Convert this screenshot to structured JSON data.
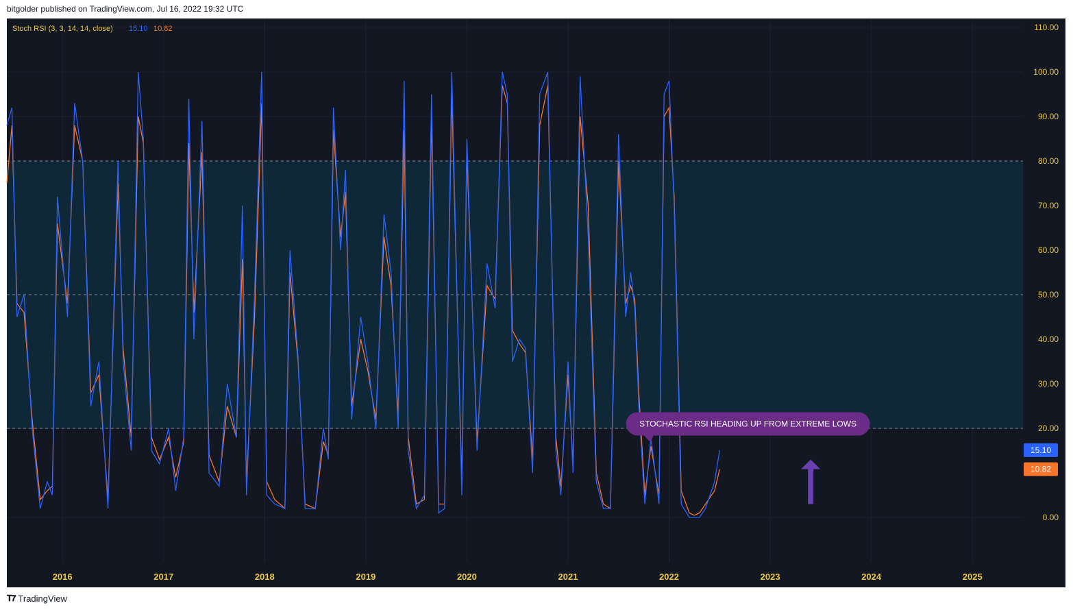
{
  "header": {
    "published_line": "bitgolder published on TradingView.com, Jul 16, 2022 19:32 UTC"
  },
  "footer": {
    "brand": "TradingView",
    "logo_icon": "tradingview-logo-icon"
  },
  "colors": {
    "background": "#131722",
    "band_fill": "#0f2a3a",
    "k_line": "#2962ff",
    "d_line": "#f7762c",
    "axis_text": "#e9c84a",
    "annotation_bg": "#6a2c86",
    "arrow": "#6a3fb0"
  },
  "chart_data": {
    "type": "line",
    "title": "",
    "indicator": {
      "name": "Stoch RSI (3, 3, 14, 14, close)",
      "k_value": "15.10",
      "d_value": "10.82"
    },
    "x_axis": {
      "labels": [
        "2016",
        "2017",
        "2018",
        "2019",
        "2020",
        "2021",
        "2022",
        "2023",
        "2024",
        "2025"
      ],
      "range": [
        2015.45,
        2025.5
      ]
    },
    "y_axis": {
      "labels": [
        "110.00",
        "100.00",
        "90.00",
        "80.00",
        "70.00",
        "60.00",
        "50.00",
        "40.00",
        "30.00",
        "20.00",
        "0.00"
      ],
      "range": [
        -10,
        112
      ]
    },
    "bands": {
      "upper": 80,
      "middle": 50,
      "lower": 20
    },
    "price_tags": [
      {
        "label": "15.10",
        "value": 15.1,
        "series": "k"
      },
      {
        "label": "10.82",
        "value": 10.82,
        "series": "d"
      }
    ],
    "annotation": {
      "text": "STOCHASTIC RSI HEADING UP FROM EXTREME LOWS",
      "x": 2022.78,
      "y": 21
    },
    "arrow": {
      "x": 2023.4,
      "y_from": 3,
      "y_to": 13
    },
    "series": [
      {
        "name": "k",
        "x": [
          2015.45,
          2015.5,
          2015.55,
          2015.62,
          2015.7,
          2015.78,
          2015.85,
          2015.9,
          2015.95,
          2016.05,
          2016.12,
          2016.2,
          2016.28,
          2016.36,
          2016.45,
          2016.55,
          2016.6,
          2016.68,
          2016.75,
          2016.8,
          2016.88,
          2016.96,
          2017.05,
          2017.12,
          2017.2,
          2017.25,
          2017.3,
          2017.38,
          2017.45,
          2017.55,
          2017.63,
          2017.72,
          2017.78,
          2017.82,
          2017.9,
          2017.97,
          2018.02,
          2018.1,
          2018.2,
          2018.25,
          2018.33,
          2018.4,
          2018.5,
          2018.58,
          2018.63,
          2018.68,
          2018.75,
          2018.8,
          2018.86,
          2018.95,
          2019.02,
          2019.1,
          2019.18,
          2019.25,
          2019.32,
          2019.38,
          2019.42,
          2019.5,
          2019.58,
          2019.65,
          2019.72,
          2019.78,
          2019.85,
          2019.95,
          2020.0,
          2020.1,
          2020.2,
          2020.28,
          2020.35,
          2020.4,
          2020.45,
          2020.52,
          2020.58,
          2020.65,
          2020.72,
          2020.8,
          2020.88,
          2020.93,
          2021.0,
          2021.05,
          2021.12,
          2021.2,
          2021.28,
          2021.35,
          2021.42,
          2021.5,
          2021.57,
          2021.62,
          2021.66,
          2021.7,
          2021.76,
          2021.82,
          2021.9,
          2021.95,
          2022.0,
          2022.05,
          2022.12,
          2022.2,
          2022.25,
          2022.3,
          2022.36,
          2022.45,
          2022.5
        ],
        "y": [
          88,
          92,
          45,
          50,
          20,
          2,
          8,
          5,
          72,
          45,
          93,
          80,
          25,
          35,
          2,
          80,
          35,
          15,
          100,
          85,
          15,
          12,
          20,
          6,
          18,
          94,
          40,
          89,
          10,
          7,
          30,
          18,
          70,
          5,
          50,
          100,
          5,
          3,
          2,
          60,
          36,
          2,
          2,
          20,
          13,
          92,
          60,
          78,
          22,
          45,
          35,
          20,
          68,
          55,
          20,
          98,
          15,
          2,
          5,
          95,
          1,
          2,
          100,
          5,
          85,
          15,
          57,
          47,
          100,
          95,
          35,
          40,
          38,
          10,
          95,
          100,
          15,
          5,
          35,
          10,
          99,
          63,
          8,
          2,
          2,
          86,
          45,
          55,
          47,
          25,
          3,
          18,
          3,
          95,
          98,
          70,
          3,
          0,
          0,
          0,
          2,
          8,
          15.1
        ]
      },
      {
        "name": "d",
        "x": [
          2015.45,
          2015.5,
          2015.55,
          2015.62,
          2015.7,
          2015.78,
          2015.85,
          2015.9,
          2015.95,
          2016.05,
          2016.12,
          2016.2,
          2016.28,
          2016.36,
          2016.45,
          2016.55,
          2016.6,
          2016.68,
          2016.75,
          2016.8,
          2016.88,
          2016.96,
          2017.05,
          2017.12,
          2017.2,
          2017.25,
          2017.3,
          2017.38,
          2017.45,
          2017.55,
          2017.63,
          2017.72,
          2017.78,
          2017.82,
          2017.9,
          2017.97,
          2018.02,
          2018.1,
          2018.2,
          2018.25,
          2018.33,
          2018.4,
          2018.5,
          2018.58,
          2018.63,
          2018.68,
          2018.75,
          2018.8,
          2018.86,
          2018.95,
          2019.02,
          2019.1,
          2019.18,
          2019.25,
          2019.32,
          2019.38,
          2019.42,
          2019.5,
          2019.58,
          2019.65,
          2019.72,
          2019.78,
          2019.85,
          2019.95,
          2020.0,
          2020.1,
          2020.2,
          2020.28,
          2020.35,
          2020.4,
          2020.45,
          2020.52,
          2020.58,
          2020.65,
          2020.72,
          2020.8,
          2020.88,
          2020.93,
          2021.0,
          2021.05,
          2021.12,
          2021.2,
          2021.28,
          2021.35,
          2021.42,
          2021.5,
          2021.57,
          2021.62,
          2021.66,
          2021.7,
          2021.76,
          2021.82,
          2021.9,
          2021.95,
          2022.0,
          2022.05,
          2022.12,
          2022.2,
          2022.25,
          2022.3,
          2022.36,
          2022.45,
          2022.5
        ],
        "y": [
          75,
          88,
          48,
          46,
          22,
          4,
          6,
          7,
          66,
          48,
          88,
          80,
          28,
          32,
          4,
          75,
          38,
          18,
          90,
          84,
          18,
          13,
          18,
          9,
          17,
          84,
          46,
          82,
          14,
          8,
          25,
          18,
          58,
          8,
          45,
          93,
          8,
          4,
          2,
          55,
          35,
          3,
          2,
          17,
          14,
          87,
          63,
          73,
          25,
          40,
          33,
          22,
          63,
          52,
          23,
          87,
          18,
          3,
          4,
          90,
          3,
          3,
          95,
          8,
          82,
          17,
          52,
          49,
          97,
          93,
          42,
          39,
          37,
          13,
          88,
          97,
          18,
          7,
          32,
          12,
          90,
          70,
          10,
          3,
          2,
          80,
          48,
          52,
          49,
          28,
          5,
          16,
          5,
          90,
          92,
          72,
          6,
          1,
          0.5,
          1,
          3,
          6,
          10.82
        ]
      }
    ]
  }
}
